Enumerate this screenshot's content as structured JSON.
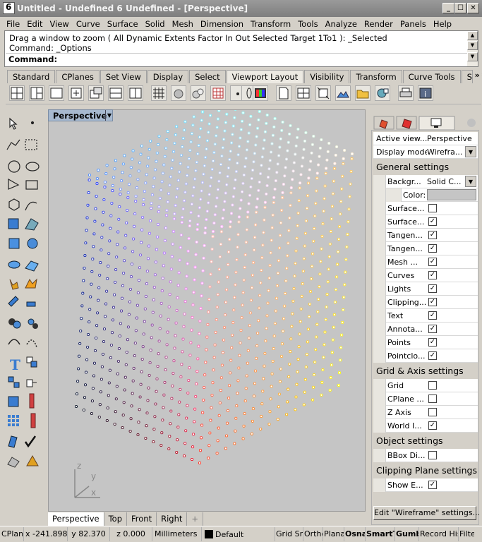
{
  "window": {
    "title": "Untitled - Undefined 6 Undefined - [Perspective]",
    "minimize": "_",
    "maximize": "☐",
    "close": "✕"
  },
  "menu": [
    "File",
    "Edit",
    "View",
    "Curve",
    "Surface",
    "Solid",
    "Mesh",
    "Dimension",
    "Transform",
    "Tools",
    "Analyze",
    "Render",
    "Panels",
    "Help"
  ],
  "command": {
    "history_line": "Drag a window to zoom ( All  Dynamic  Extents  Factor  In  Out  Selected  Target  1To1 ): _Selected",
    "last_line": "Command: _Options",
    "prompt": "Command:"
  },
  "toolbar_tabs": [
    "Standard",
    "CPlanes",
    "Set View",
    "Display",
    "Select",
    "Viewport Layout",
    "Visibility",
    "Transform",
    "Curve Tools",
    "Surface To"
  ],
  "active_toolbar_tab": "Viewport Layout",
  "toolbar_more": "»",
  "viewport": {
    "label": "Perspective",
    "tabs": [
      "Perspective",
      "Top",
      "Front",
      "Right"
    ],
    "add_tab": "+",
    "axis_z": "z",
    "axis_y": "y",
    "axis_x": "x"
  },
  "panel": {
    "active_view_label": "Active view...",
    "active_view_value": "Perspective",
    "display_mode_label": "Display mode",
    "display_mode_value": "Wirefra...",
    "general_settings": "General settings",
    "background_label": "Backgr...",
    "background_value": "Solid C...",
    "color_label": "Color:",
    "general_items": [
      {
        "label": "Surface...",
        "checked": false
      },
      {
        "label": "Surface...",
        "checked": true
      },
      {
        "label": "Tangen...",
        "checked": true
      },
      {
        "label": "Tangen...",
        "checked": true
      },
      {
        "label": "Mesh ...",
        "checked": true
      },
      {
        "label": "Curves",
        "checked": true
      },
      {
        "label": "Lights",
        "checked": true
      },
      {
        "label": "Clipping...",
        "checked": true
      },
      {
        "label": "Text",
        "checked": true
      },
      {
        "label": "Annota...",
        "checked": true
      },
      {
        "label": "Points",
        "checked": true
      },
      {
        "label": "Pointclo...",
        "checked": true
      }
    ],
    "grid_settings": "Grid & Axis settings",
    "grid_items": [
      {
        "label": "Grid",
        "checked": false
      },
      {
        "label": "CPlane ...",
        "checked": false
      },
      {
        "label": "Z Axis",
        "checked": false
      },
      {
        "label": "World I...",
        "checked": true
      }
    ],
    "object_settings": "Object settings",
    "object_items": [
      {
        "label": "BBox Di...",
        "checked": false
      }
    ],
    "clipping_settings": "Clipping Plane settings",
    "clipping_items": [
      {
        "label": "Show E...",
        "checked": true
      }
    ],
    "edit_button": "Edit \"Wireframe\" settings..."
  },
  "status": {
    "cplane": "CPlane",
    "x": "x -241.898",
    "y": "y 82.370",
    "z": "z 0.000",
    "units": "Millimeters",
    "layer": "Default",
    "grid_snap": "Grid Sna",
    "ortho": "Ortho",
    "planar": "Planar",
    "osnap": "Osna",
    "smarttrack": "SmartT",
    "gumball": "Gumb",
    "record_history": "Record Hist",
    "filter": "Filte"
  }
}
